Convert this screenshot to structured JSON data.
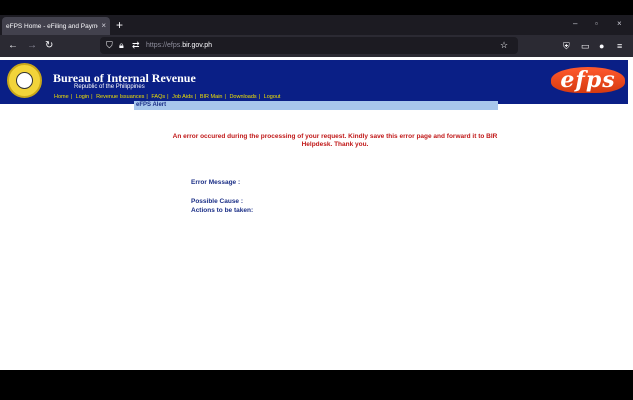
{
  "browser": {
    "tab_title": "eFPS Home - eFiling and Payment",
    "tab_close": "×",
    "new_tab": "+",
    "window_controls": {
      "minimize": "–",
      "maximize": "▫",
      "close": "×"
    },
    "url": {
      "prefix": "https://efps.",
      "domain": "bir.gov.ph"
    },
    "icons": [
      "back-arrow-icon",
      "forward-arrow-icon",
      "reload-icon",
      "shield-icon",
      "lock-icon",
      "permissions-icon",
      "bookmark-star-icon",
      "pocket-icon",
      "reader-view-icon",
      "account-icon",
      "menu-icon"
    ]
  },
  "site": {
    "org_title": "Bureau of Internal Revenue",
    "org_subtitle": "Republic of the Philippines",
    "logo_text": "efps",
    "nav_links": [
      "Home",
      "Login",
      "Revenue Issuances",
      "FAQs",
      "Job Aids",
      "BIR Main",
      "Downloads",
      "Logout"
    ],
    "nav_color": "#f0e000",
    "header_color": "#0a1f86"
  },
  "alert": {
    "title": "eFPS Alert",
    "message": "An error occured during the processing of your request. Kindly save this error page and forward it to BIR Helpdesk. Thank you.",
    "error_message_label": "Error Message :",
    "possible_cause_label": "Possible Cause :",
    "actions_label": "Actions to be taken:",
    "message_color": "#c01818",
    "label_color": "#1a2e86"
  }
}
